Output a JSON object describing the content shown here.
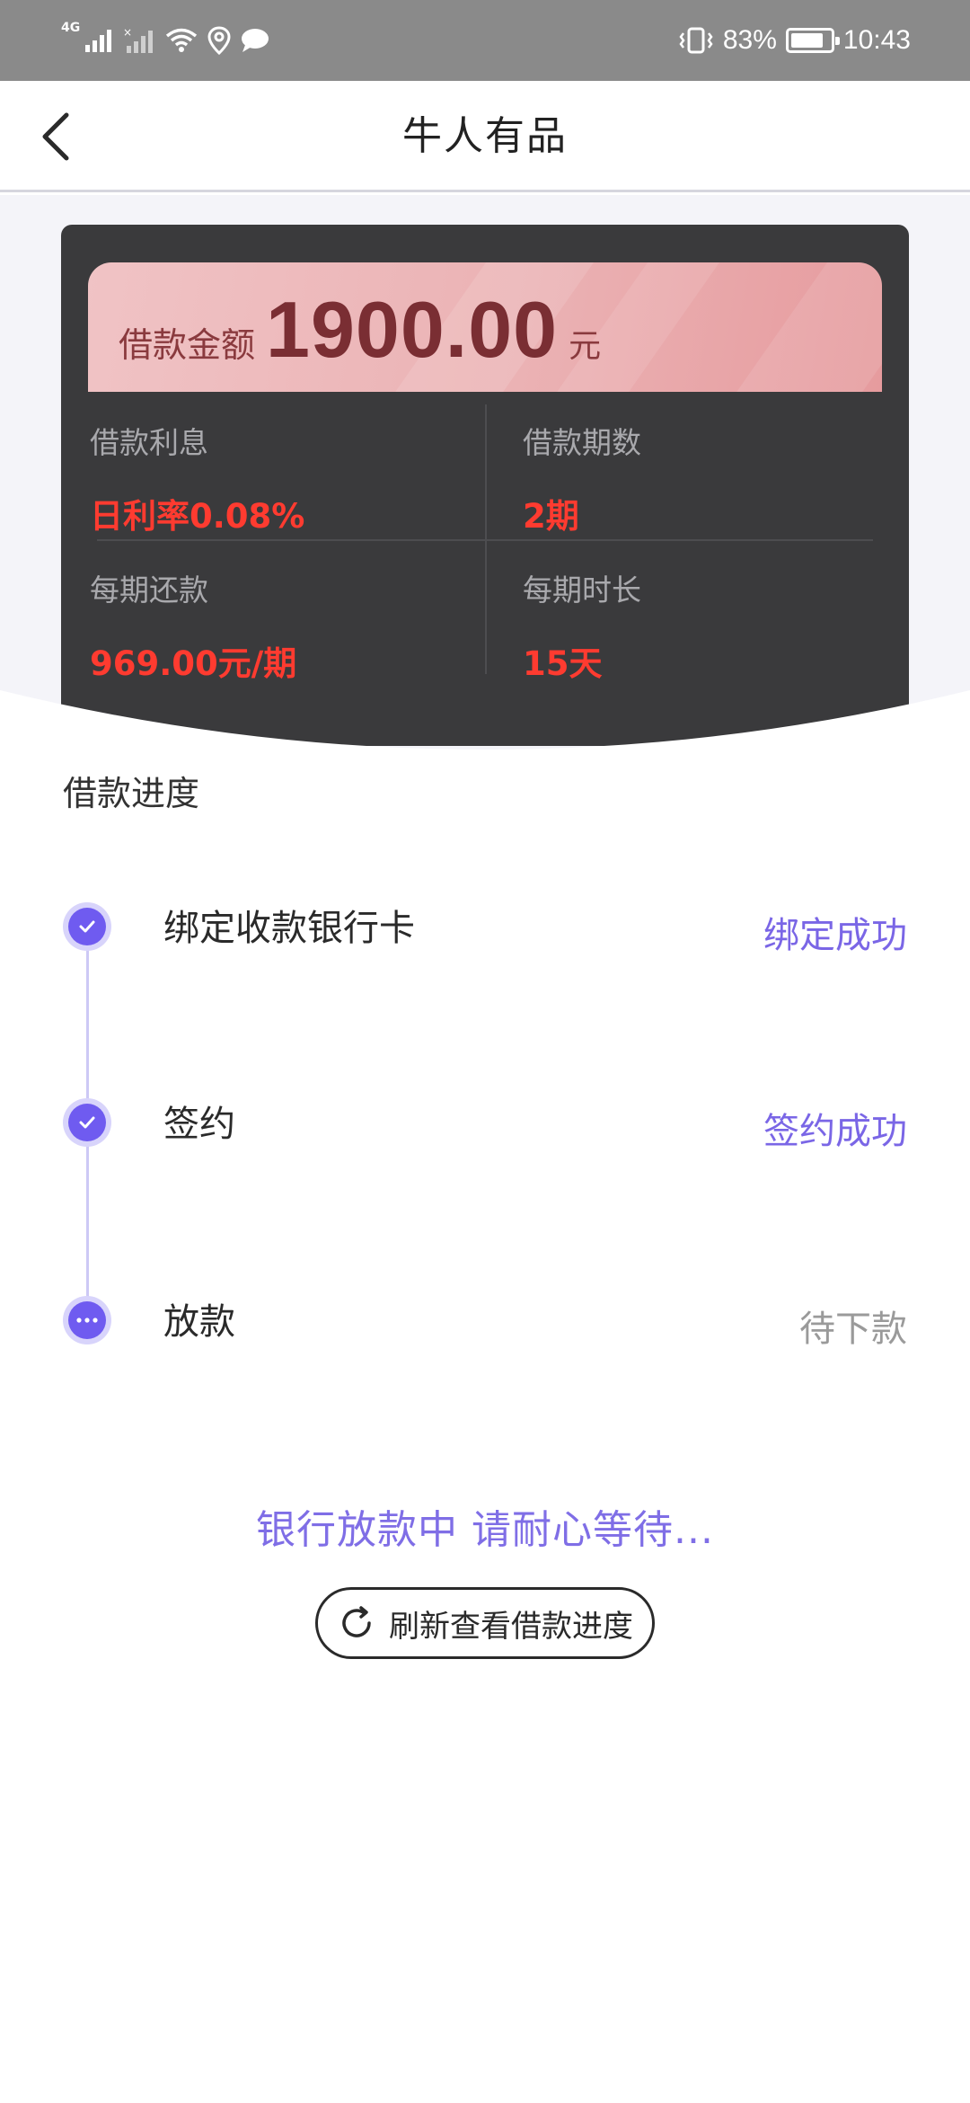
{
  "status_bar": {
    "network_label": "4G",
    "battery_percent_text": "83%",
    "battery_level": 0.83,
    "time": "10:43",
    "icons": [
      "signal-icon",
      "no-signal-icon",
      "wifi-icon",
      "location-icon",
      "message-icon",
      "vibrate-icon",
      "battery-icon"
    ]
  },
  "nav": {
    "title": "牛人有品",
    "back_icon": "chevron-left-icon"
  },
  "loan": {
    "amount_label": "借款金额",
    "amount_value": "1900.00",
    "amount_unit": "元",
    "interest_label": "借款利息",
    "interest_value": "日利率0.08%",
    "periods_label": "借款期数",
    "periods_value": "2期",
    "installment_label": "每期还款",
    "installment_value": "969.00元/期",
    "duration_label": "每期时长",
    "duration_value": "15天"
  },
  "progress": {
    "title": "借款进度",
    "steps": [
      {
        "title": "绑定收款银行卡",
        "status": "绑定成功",
        "state": "done"
      },
      {
        "title": "签约",
        "status": "签约成功",
        "state": "done"
      },
      {
        "title": "放款",
        "status": "待下款",
        "state": "pending"
      }
    ]
  },
  "waiting_text": "银行放款中 请耐心等待...",
  "refresh_button": {
    "label": "刷新查看借款进度",
    "icon": "refresh-icon"
  },
  "colors": {
    "accent": "#6f5bf0",
    "status_done": "#7a66e6",
    "highlight_red": "#ff3b30",
    "card_bg": "#3a3a3c"
  }
}
